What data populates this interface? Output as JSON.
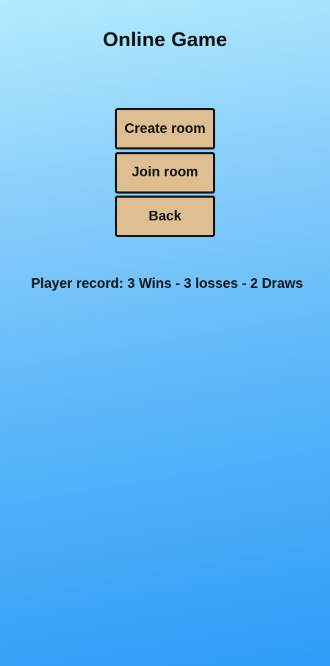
{
  "screen": {
    "title": "Online Game",
    "background_top": "#b4ebfd",
    "background_bottom": "#2e9cf8"
  },
  "menu": {
    "create_room_label": "Create room",
    "join_room_label": "Join room",
    "back_label": "Back",
    "button_color": "#dfbf92"
  },
  "stats": {
    "record_text": "Player record: 3 Wins - 3 losses - 2 Draws"
  }
}
